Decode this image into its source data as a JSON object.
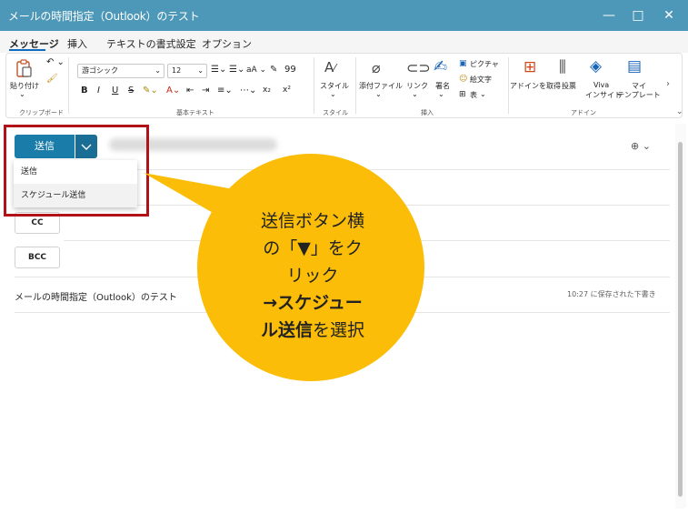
{
  "window": {
    "title": "メールの時間指定（Outlook）のテスト",
    "minimize_icon": "minimize-icon",
    "maximize_icon": "maximize-icon",
    "close_icon": "close-icon"
  },
  "tabs": [
    {
      "label": "メッセージ",
      "active": true
    },
    {
      "label": "挿入"
    },
    {
      "label": "テキストの書式設定"
    },
    {
      "label": "オプション"
    }
  ],
  "ribbon": {
    "clipboard": {
      "paste_label": "貼り付け",
      "group_label": "クリップボード"
    },
    "basic_text": {
      "font_name": "游ゴシック",
      "font_size": "12",
      "group_label": "基本テキスト"
    },
    "style": {
      "label": "スタイル",
      "group_label": "スタイル"
    },
    "insert": {
      "attach_label": "添付ファイル",
      "link_label": "リンク",
      "signature_label": "署名",
      "picture_label": "ピクチャ",
      "emoji_label": "絵文字",
      "table_label": "表",
      "group_label": "挿入"
    },
    "addins": {
      "get_addins_label": "アドインを取得",
      "poll_label": "投票",
      "viva_label1": "Viva",
      "viva_label2": "インサイト",
      "my_templates_label1": "マイ",
      "my_templates_label2": "テンプレート",
      "group_label": "アドイン"
    }
  },
  "compose": {
    "send_label": "送信",
    "dropdown_items": [
      "送信",
      "スケジュール送信"
    ],
    "cc_label": "CC",
    "bcc_label": "BCC",
    "subject": "メールの時間指定（Outlook）のテスト",
    "saved_status": "10:27 に保存された下書き"
  },
  "callout": {
    "line1": "送信ボタン横",
    "line2": "の「▼」をク",
    "line3": "リック",
    "line4_bold": "→スケジュー",
    "line5_bold": "ル送信",
    "line5_rest": "を選択"
  },
  "colors": {
    "titlebar": "#4d98b8",
    "send_button": "#1a7ca9",
    "callout_fill": "#fbbd08",
    "highlight_border": "#b01218"
  }
}
